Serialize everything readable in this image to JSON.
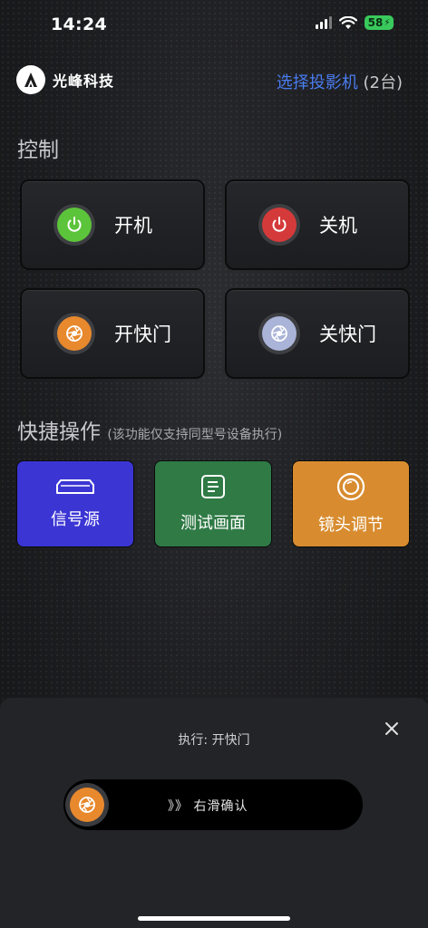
{
  "status": {
    "time": "14:24",
    "battery": "58"
  },
  "header": {
    "brand": "光峰科技",
    "select_link": "选择投影机",
    "select_count": "(2台)"
  },
  "control": {
    "title": "控制",
    "buttons": [
      {
        "label": "开机",
        "color": "#5cc43a",
        "icon": "power-icon"
      },
      {
        "label": "关机",
        "color": "#d53a3a",
        "icon": "power-icon"
      },
      {
        "label": "开快门",
        "color": "#e8892d",
        "icon": "shutter-icon"
      },
      {
        "label": "关快门",
        "color": "#aab4d8",
        "icon": "shutter-icon"
      }
    ]
  },
  "quick": {
    "title": "快捷操作",
    "note": "(该功能仅支持同型号设备执行)",
    "buttons": [
      {
        "label": "信号源",
        "color": "#3b35d4",
        "icon": "signal-source-icon"
      },
      {
        "label": "测试画面",
        "color": "#2f7a45",
        "icon": "test-pattern-icon"
      },
      {
        "label": "镜头调节",
        "color": "#d88c2f",
        "icon": "lens-icon"
      }
    ]
  },
  "sheet": {
    "title": "执行: 开快门",
    "slider_text": "》》 右滑确认",
    "thumb_color": "#e8892d"
  }
}
